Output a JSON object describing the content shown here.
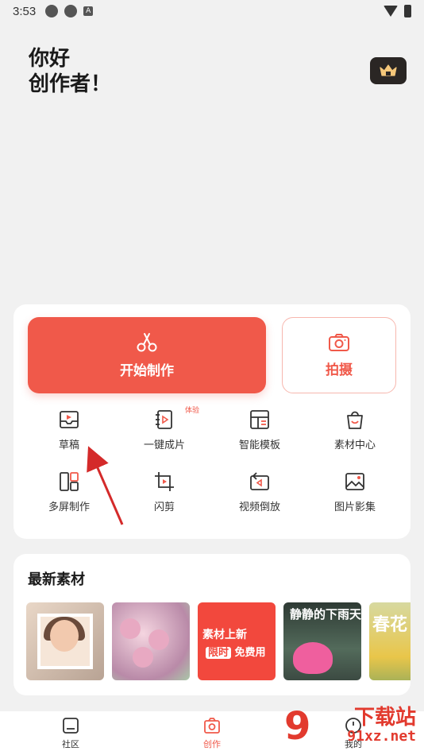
{
  "status_bar": {
    "time": "3:53"
  },
  "greeting": {
    "line1": "你好",
    "line2": "创作者！"
  },
  "main_actions": {
    "start_label": "开始制作",
    "shoot_label": "拍摄"
  },
  "tools": [
    {
      "label": "草稿",
      "icon": "draft-icon"
    },
    {
      "label": "一键成片",
      "icon": "one-click-video-icon",
      "badge": "体验"
    },
    {
      "label": "智能模板",
      "icon": "template-icon"
    },
    {
      "label": "素材中心",
      "icon": "material-bag-icon"
    },
    {
      "label": "多屏制作",
      "icon": "multi-screen-icon"
    },
    {
      "label": "闪剪",
      "icon": "quick-cut-icon"
    },
    {
      "label": "视频倒放",
      "icon": "reverse-icon"
    },
    {
      "label": "图片影集",
      "icon": "photo-album-icon"
    }
  ],
  "materials": {
    "title": "最新素材",
    "thumb3_line1": "素材上新",
    "thumb3_line2_highlight": "限时",
    "thumb3_line2_rest": "免费用",
    "thumb4_text": "静静的下雨天",
    "thumb5_text": "春花"
  },
  "bottom_nav": [
    {
      "label": "社区",
      "active": false
    },
    {
      "label": "创作",
      "active": true
    },
    {
      "label": "我的",
      "active": false
    }
  ],
  "watermark": {
    "brand": "下载站",
    "domain": "91xz.net",
    "logo": "9"
  },
  "colors": {
    "accent": "#f0594a",
    "dark_button": "#2a2624"
  }
}
